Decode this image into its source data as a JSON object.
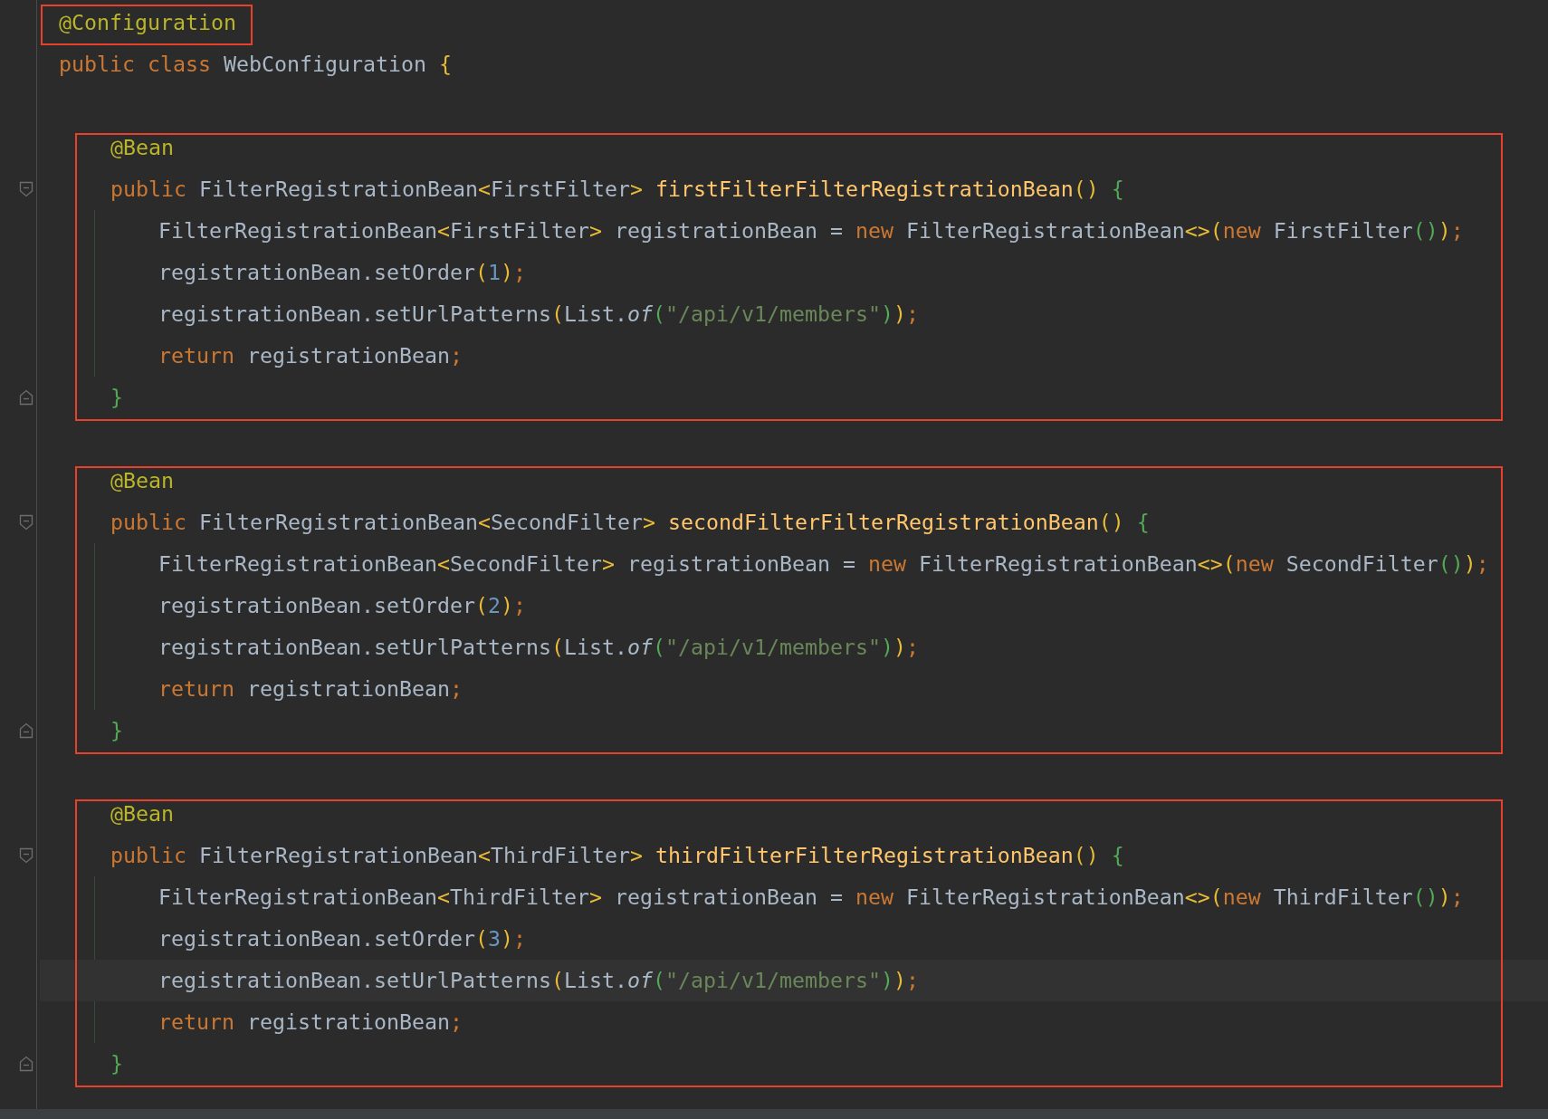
{
  "code": [
    {
      "kind": "header",
      "outlined": true,
      "lines": [
        {
          "tokens": [
            {
              "text": "@Configuration",
              "kind": "annotation"
            }
          ]
        }
      ]
    },
    {
      "kind": "plain",
      "lines": [
        {
          "tokens": [
            {
              "text": "public class ",
              "kind": "keyword"
            },
            {
              "text": "WebConfiguration ",
              "kind": "plain"
            },
            {
              "text": "{",
              "kind": "yellow"
            }
          ]
        }
      ]
    },
    {
      "kind": "method",
      "outlined": true,
      "lines": [
        {
          "fold": false,
          "tokens": [
            {
              "text": "@Bean",
              "kind": "annotation"
            }
          ]
        },
        {
          "fold": true,
          "tokens": [
            {
              "text": "public ",
              "kind": "keyword"
            },
            {
              "text": "FilterRegistrationBean",
              "kind": "plain"
            },
            {
              "text": "<",
              "kind": "yellow"
            },
            {
              "text": "FirstFilter",
              "kind": "plain"
            },
            {
              "text": "> ",
              "kind": "yellow"
            },
            {
              "text": "firstFilterFilterRegistrationBean",
              "kind": "method"
            },
            {
              "text": "() ",
              "kind": "yellow"
            },
            {
              "text": "{",
              "kind": "green"
            }
          ]
        }
      ],
      "body": [
        {
          "current": false,
          "tokens": [
            {
              "text": "FilterRegistrationBean",
              "kind": "plain"
            },
            {
              "text": "<",
              "kind": "yellow"
            },
            {
              "text": "FirstFilter",
              "kind": "plain"
            },
            {
              "text": "> ",
              "kind": "yellow"
            },
            {
              "text": "registrationBean = ",
              "kind": "plain"
            },
            {
              "text": "new ",
              "kind": "keyword"
            },
            {
              "text": "FilterRegistrationBean",
              "kind": "plain"
            },
            {
              "text": "<>(",
              "kind": "yellow"
            },
            {
              "text": "new ",
              "kind": "keyword"
            },
            {
              "text": "FirstFilter",
              "kind": "plain"
            },
            {
              "text": "()",
              "kind": "green"
            },
            {
              "text": ")",
              "kind": "yellow"
            },
            {
              "text": ";",
              "kind": "punct"
            }
          ]
        },
        {
          "current": false,
          "tokens": [
            {
              "text": "registrationBean.setOrder",
              "kind": "plain"
            },
            {
              "text": "(",
              "kind": "yellow"
            },
            {
              "text": "1",
              "kind": "number"
            },
            {
              "text": ")",
              "kind": "yellow"
            },
            {
              "text": ";",
              "kind": "punct"
            }
          ]
        },
        {
          "current": false,
          "tokens": [
            {
              "text": "registrationBean.setUrlPatterns",
              "kind": "plain"
            },
            {
              "text": "(",
              "kind": "yellow"
            },
            {
              "text": "List.",
              "kind": "plain"
            },
            {
              "text": "of",
              "kind": "italic"
            },
            {
              "text": "(",
              "kind": "green"
            },
            {
              "text": "\"/api/v1/members\"",
              "kind": "string"
            },
            {
              "text": ")",
              "kind": "green"
            },
            {
              "text": ")",
              "kind": "yellow"
            },
            {
              "text": ";",
              "kind": "punct"
            }
          ]
        },
        {
          "current": false,
          "tokens": [
            {
              "text": "return ",
              "kind": "keyword"
            },
            {
              "text": "registrationBean",
              "kind": "plain"
            },
            {
              "text": ";",
              "kind": "punct"
            }
          ]
        }
      ],
      "closing": {
        "fold": true,
        "tokens": [
          {
            "text": "}",
            "kind": "green"
          }
        ]
      }
    },
    {
      "kind": "method",
      "outlined": true,
      "lines": [
        {
          "fold": false,
          "tokens": [
            {
              "text": "@Bean",
              "kind": "annotation"
            }
          ]
        },
        {
          "fold": true,
          "tokens": [
            {
              "text": "public ",
              "kind": "keyword"
            },
            {
              "text": "FilterRegistrationBean",
              "kind": "plain"
            },
            {
              "text": "<",
              "kind": "yellow"
            },
            {
              "text": "SecondFilter",
              "kind": "plain"
            },
            {
              "text": "> ",
              "kind": "yellow"
            },
            {
              "text": "secondFilterFilterRegistrationBean",
              "kind": "method"
            },
            {
              "text": "() ",
              "kind": "yellow"
            },
            {
              "text": "{",
              "kind": "green"
            }
          ]
        }
      ],
      "body": [
        {
          "current": false,
          "tokens": [
            {
              "text": "FilterRegistrationBean",
              "kind": "plain"
            },
            {
              "text": "<",
              "kind": "yellow"
            },
            {
              "text": "SecondFilter",
              "kind": "plain"
            },
            {
              "text": "> ",
              "kind": "yellow"
            },
            {
              "text": "registrationBean = ",
              "kind": "plain"
            },
            {
              "text": "new ",
              "kind": "keyword"
            },
            {
              "text": "FilterRegistrationBean",
              "kind": "plain"
            },
            {
              "text": "<>(",
              "kind": "yellow"
            },
            {
              "text": "new ",
              "kind": "keyword"
            },
            {
              "text": "SecondFilter",
              "kind": "plain"
            },
            {
              "text": "()",
              "kind": "green"
            },
            {
              "text": ")",
              "kind": "yellow"
            },
            {
              "text": ";",
              "kind": "punct"
            }
          ]
        },
        {
          "current": false,
          "tokens": [
            {
              "text": "registrationBean.setOrder",
              "kind": "plain"
            },
            {
              "text": "(",
              "kind": "yellow"
            },
            {
              "text": "2",
              "kind": "number"
            },
            {
              "text": ")",
              "kind": "yellow"
            },
            {
              "text": ";",
              "kind": "punct"
            }
          ]
        },
        {
          "current": false,
          "tokens": [
            {
              "text": "registrationBean.setUrlPatterns",
              "kind": "plain"
            },
            {
              "text": "(",
              "kind": "yellow"
            },
            {
              "text": "List.",
              "kind": "plain"
            },
            {
              "text": "of",
              "kind": "italic"
            },
            {
              "text": "(",
              "kind": "green"
            },
            {
              "text": "\"/api/v1/members\"",
              "kind": "string"
            },
            {
              "text": ")",
              "kind": "green"
            },
            {
              "text": ")",
              "kind": "yellow"
            },
            {
              "text": ";",
              "kind": "punct"
            }
          ]
        },
        {
          "current": false,
          "tokens": [
            {
              "text": "return ",
              "kind": "keyword"
            },
            {
              "text": "registrationBean",
              "kind": "plain"
            },
            {
              "text": ";",
              "kind": "punct"
            }
          ]
        }
      ],
      "closing": {
        "fold": true,
        "tokens": [
          {
            "text": "}",
            "kind": "green"
          }
        ]
      }
    },
    {
      "kind": "method",
      "outlined": true,
      "lines": [
        {
          "fold": false,
          "tokens": [
            {
              "text": "@Bean",
              "kind": "annotation"
            }
          ]
        },
        {
          "fold": true,
          "tokens": [
            {
              "text": "public ",
              "kind": "keyword"
            },
            {
              "text": "FilterRegistrationBean",
              "kind": "plain"
            },
            {
              "text": "<",
              "kind": "yellow"
            },
            {
              "text": "ThirdFilter",
              "kind": "plain"
            },
            {
              "text": "> ",
              "kind": "yellow"
            },
            {
              "text": "thirdFilterFilterRegistrationBean",
              "kind": "method"
            },
            {
              "text": "() ",
              "kind": "yellow"
            },
            {
              "text": "{",
              "kind": "green"
            }
          ]
        }
      ],
      "body": [
        {
          "current": false,
          "tokens": [
            {
              "text": "FilterRegistrationBean",
              "kind": "plain"
            },
            {
              "text": "<",
              "kind": "yellow"
            },
            {
              "text": "ThirdFilter",
              "kind": "plain"
            },
            {
              "text": "> ",
              "kind": "yellow"
            },
            {
              "text": "registrationBean = ",
              "kind": "plain"
            },
            {
              "text": "new ",
              "kind": "keyword"
            },
            {
              "text": "FilterRegistrationBean",
              "kind": "plain"
            },
            {
              "text": "<>(",
              "kind": "yellow"
            },
            {
              "text": "new ",
              "kind": "keyword"
            },
            {
              "text": "ThirdFilter",
              "kind": "plain"
            },
            {
              "text": "()",
              "kind": "green"
            },
            {
              "text": ")",
              "kind": "yellow"
            },
            {
              "text": ";",
              "kind": "punct"
            }
          ]
        },
        {
          "current": false,
          "tokens": [
            {
              "text": "registrationBean.setOrder",
              "kind": "plain"
            },
            {
              "text": "(",
              "kind": "yellow"
            },
            {
              "text": "3",
              "kind": "number"
            },
            {
              "text": ")",
              "kind": "yellow"
            },
            {
              "text": ";",
              "kind": "punct"
            }
          ]
        },
        {
          "current": true,
          "tokens": [
            {
              "text": "registrationBean.setUrlPatterns",
              "kind": "plain"
            },
            {
              "text": "(",
              "kind": "yellow"
            },
            {
              "text": "List.",
              "kind": "plain"
            },
            {
              "text": "of",
              "kind": "italic"
            },
            {
              "text": "(",
              "kind": "green"
            },
            {
              "text": "\"/api/v1/members\"",
              "kind": "string"
            },
            {
              "text": ")",
              "kind": "green"
            },
            {
              "text": ")",
              "kind": "yellow"
            },
            {
              "text": ";",
              "kind": "punct"
            }
          ]
        },
        {
          "current": false,
          "tokens": [
            {
              "text": "return ",
              "kind": "keyword"
            },
            {
              "text": "registrationBean",
              "kind": "plain"
            },
            {
              "text": ";",
              "kind": "punct"
            }
          ]
        }
      ],
      "closing": {
        "fold": true,
        "tokens": [
          {
            "text": "}",
            "kind": "green"
          }
        ]
      }
    }
  ]
}
